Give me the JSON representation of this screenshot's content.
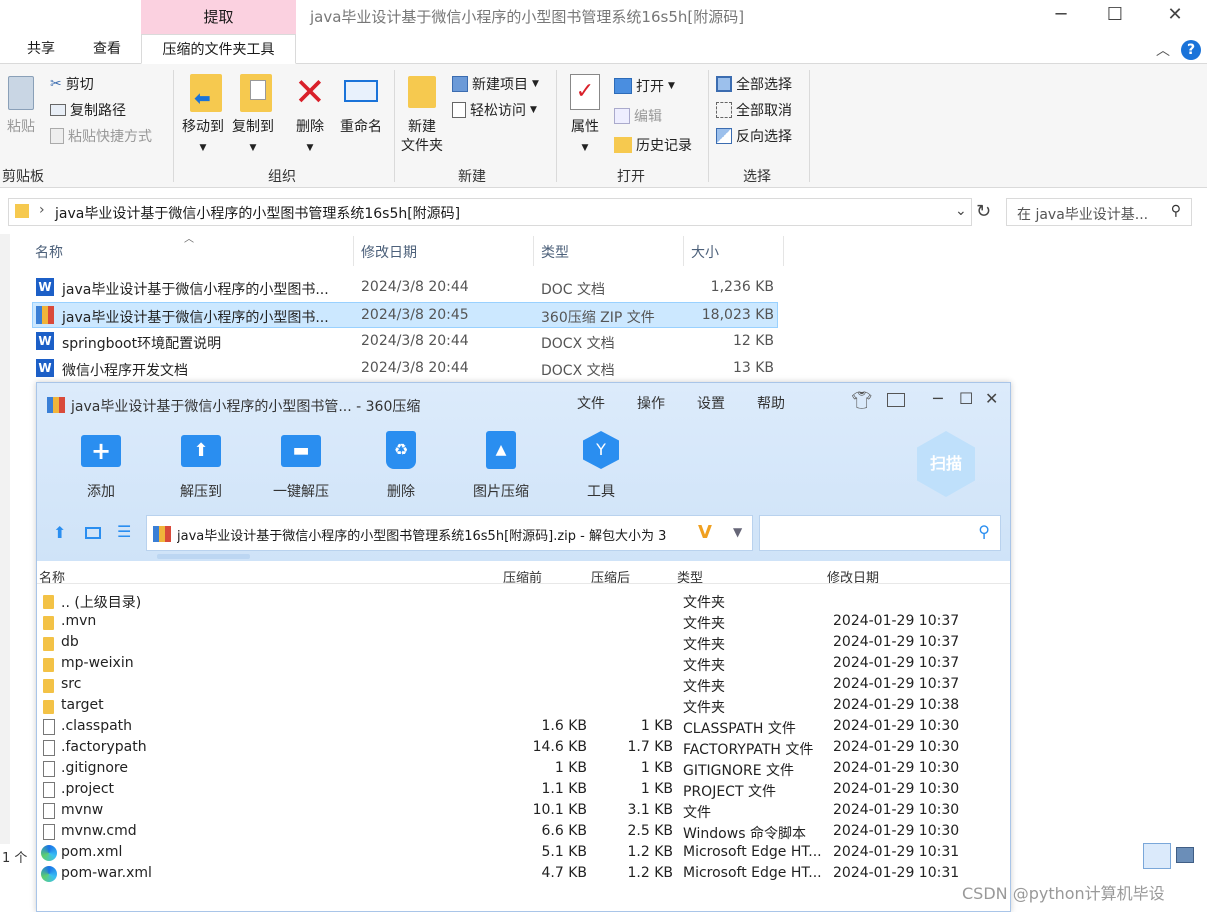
{
  "explorer": {
    "context_tab": "提取",
    "title": "java毕业设计基于微信小程序的小型图书管理系统16s5h[附源码]",
    "tabs": [
      "共享",
      "查看",
      "压缩的文件夹工具"
    ],
    "clipboard": {
      "paste": "粘贴",
      "cut": "剪切",
      "copy_path": "复制路径",
      "paste_shortcut": "粘贴快捷方式",
      "group": "剪贴板"
    },
    "organize": {
      "move_to": "移动到",
      "copy_to": "复制到",
      "delete": "删除",
      "rename": "重命名",
      "group": "组织"
    },
    "new": {
      "new_folder_1": "新建",
      "new_folder_2": "文件夹",
      "new_item": "新建项目",
      "easy_access": "轻松访问",
      "group": "新建"
    },
    "open": {
      "properties": "属性",
      "open": "打开",
      "edit": "编辑",
      "history": "历史记录",
      "group": "打开"
    },
    "select": {
      "select_all": "全部选择",
      "select_none": "全部取消",
      "invert": "反向选择",
      "group": "选择"
    },
    "address": "java毕业设计基于微信小程序的小型图书管理系统16s5h[附源码]",
    "search_placeholder": "在 java毕业设计基...",
    "columns": {
      "name": "名称",
      "modified": "修改日期",
      "type": "类型",
      "size": "大小"
    },
    "files": [
      {
        "name": "java毕业设计基于微信小程序的小型图书...",
        "modified": "2024/3/8 20:44",
        "type": "DOC 文档",
        "size": "1,236 KB",
        "icon": "word-icon"
      },
      {
        "name": "java毕业设计基于微信小程序的小型图书...",
        "modified": "2024/3/8 20:45",
        "type": "360压缩 ZIP 文件",
        "size": "18,023 KB",
        "icon": "zip-icon"
      },
      {
        "name": "springboot环境配置说明",
        "modified": "2024/3/8 20:44",
        "type": "DOCX 文档",
        "size": "12 KB",
        "icon": "word-icon"
      },
      {
        "name": "微信小程序开发文档",
        "modified": "2024/3/8 20:44",
        "type": "DOCX 文档",
        "size": "13 KB",
        "icon": "word-icon"
      }
    ],
    "status_left": "1 个"
  },
  "zip": {
    "title": "java毕业设计基于微信小程序的小型图书管... - 360压缩",
    "menu": [
      "文件",
      "操作",
      "设置",
      "帮助"
    ],
    "tools": [
      "添加",
      "解压到",
      "一键解压",
      "删除",
      "图片压缩",
      "工具"
    ],
    "scan": "扫描",
    "path": "java毕业设计基于微信小程序的小型图书管理系统16s5h[附源码].zip - 解包大小为 3",
    "columns": {
      "name": "名称",
      "before": "压缩前",
      "after": "压缩后",
      "type": "类型",
      "modified": "修改日期"
    },
    "rows": [
      {
        "name": ".. (上级目录)",
        "before": "",
        "after": "",
        "type": "文件夹",
        "modified": "",
        "kind": "folder"
      },
      {
        "name": ".mvn",
        "before": "",
        "after": "",
        "type": "文件夹",
        "modified": "2024-01-29 10:37",
        "kind": "folder"
      },
      {
        "name": "db",
        "before": "",
        "after": "",
        "type": "文件夹",
        "modified": "2024-01-29 10:37",
        "kind": "folder"
      },
      {
        "name": "mp-weixin",
        "before": "",
        "after": "",
        "type": "文件夹",
        "modified": "2024-01-29 10:37",
        "kind": "folder"
      },
      {
        "name": "src",
        "before": "",
        "after": "",
        "type": "文件夹",
        "modified": "2024-01-29 10:37",
        "kind": "folder"
      },
      {
        "name": "target",
        "before": "",
        "after": "",
        "type": "文件夹",
        "modified": "2024-01-29 10:38",
        "kind": "folder"
      },
      {
        "name": ".classpath",
        "before": "1.6 KB",
        "after": "1 KB",
        "type": "CLASSPATH 文件",
        "modified": "2024-01-29 10:30",
        "kind": "file"
      },
      {
        "name": ".factorypath",
        "before": "14.6 KB",
        "after": "1.7 KB",
        "type": "FACTORYPATH 文件",
        "modified": "2024-01-29 10:30",
        "kind": "file"
      },
      {
        "name": ".gitignore",
        "before": "1 KB",
        "after": "1 KB",
        "type": "GITIGNORE 文件",
        "modified": "2024-01-29 10:30",
        "kind": "file"
      },
      {
        "name": ".project",
        "before": "1.1 KB",
        "after": "1 KB",
        "type": "PROJECT 文件",
        "modified": "2024-01-29 10:30",
        "kind": "file"
      },
      {
        "name": "mvnw",
        "before": "10.1 KB",
        "after": "3.1 KB",
        "type": "文件",
        "modified": "2024-01-29 10:30",
        "kind": "file"
      },
      {
        "name": "mvnw.cmd",
        "before": "6.6 KB",
        "after": "2.5 KB",
        "type": "Windows 命令脚本",
        "modified": "2024-01-29 10:30",
        "kind": "file"
      },
      {
        "name": "pom.xml",
        "before": "5.1 KB",
        "after": "1.2 KB",
        "type": "Microsoft Edge HT...",
        "modified": "2024-01-29 10:31",
        "kind": "edge"
      },
      {
        "name": "pom-war.xml",
        "before": "4.7 KB",
        "after": "1.2 KB",
        "type": "Microsoft Edge HT...",
        "modified": "2024-01-29 10:31",
        "kind": "edge"
      }
    ]
  },
  "watermark": "CSDN @python计算机毕设"
}
